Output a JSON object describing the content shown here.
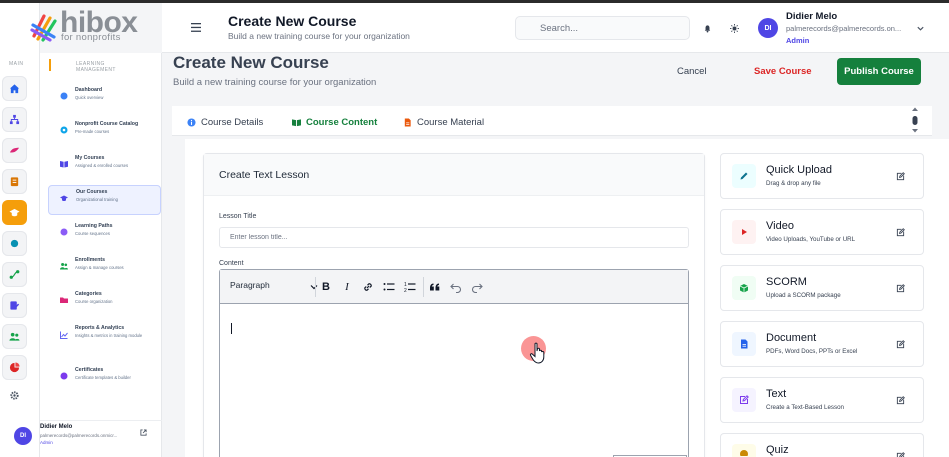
{
  "brand": {
    "name": "hibox",
    "tagline": "for nonprofits"
  },
  "rail": {
    "section": "MAIN"
  },
  "sidebar": {
    "section": "LEARNING MANAGEMENT",
    "items": [
      {
        "title": "Dashboard",
        "subtitle": "Quick overview",
        "icon": "dashboard-icon",
        "color": "#3b82f6"
      },
      {
        "title": "Nonprofit Course Catalog",
        "subtitle": "Pre-made courses",
        "icon": "catalog-icon",
        "color": "#0ea5e9"
      },
      {
        "title": "My Courses",
        "subtitle": "Assigned & enrolled courses",
        "icon": "book-icon",
        "color": "#4f46e5"
      },
      {
        "title": "Our Courses",
        "subtitle": "Organizational training",
        "icon": "graduation-cap-icon",
        "color": "#4f46e5"
      },
      {
        "title": "Learning Paths",
        "subtitle": "Course sequences",
        "icon": "path-icon",
        "color": "#8b5cf6"
      },
      {
        "title": "Enrollments",
        "subtitle": "Assign & manage courses",
        "icon": "users-icon",
        "color": "#16a34a"
      },
      {
        "title": "Categories",
        "subtitle": "Course organization",
        "icon": "folder-icon",
        "color": "#db2777"
      },
      {
        "title": "Reports & Analytics",
        "subtitle": "Insights & metrics in training module",
        "icon": "chart-icon",
        "color": "#6366f1"
      },
      {
        "title": "Certificates",
        "subtitle": "Certificate templates & builder",
        "icon": "certificate-icon",
        "color": "#7c3aed"
      }
    ],
    "user": {
      "initials": "DI",
      "name": "Didier Melo",
      "email": "palmerecords@palmerecords.onmicr...",
      "role": "Admin"
    }
  },
  "header": {
    "title": "Create New Course",
    "subtitle": "Build a new training course for your organization",
    "search_placeholder": "Search...",
    "user": {
      "initials": "DI",
      "name": "Didier Melo",
      "email": "palmerecords@palmerecords.on...",
      "role": "Admin"
    }
  },
  "page": {
    "title": "Create New Course",
    "subtitle": "Build a new training course for your organization",
    "actions": {
      "cancel": "Cancel",
      "save": "Save Course",
      "publish": "Publish Course"
    }
  },
  "tabs": [
    {
      "label": "Course Details",
      "icon": "info-icon"
    },
    {
      "label": "Course Content",
      "icon": "book-open-icon",
      "active": true
    },
    {
      "label": "Course Material",
      "icon": "document-icon"
    }
  ],
  "lesson": {
    "heading": "Create Text Lesson",
    "title_label": "Lesson Title",
    "title_placeholder": "Enter lesson title...",
    "content_label": "Content",
    "block_format": "Paragraph"
  },
  "content_types": [
    {
      "title": "Quick Upload",
      "subtitle": "Drag & drop any file",
      "icon": "pencil-icon",
      "color": "#0e7490",
      "bg": "#ecfeff"
    },
    {
      "title": "Video",
      "subtitle": "Video Uploads, YouTube or URL",
      "icon": "play-icon",
      "color": "#dc2626",
      "bg": "#fef2f2"
    },
    {
      "title": "SCORM",
      "subtitle": "Upload a SCORM package",
      "icon": "package-icon",
      "color": "#16a34a",
      "bg": "#f0fdf4"
    },
    {
      "title": "Document",
      "subtitle": "PDFs, Word Docs, PPTs or Excel",
      "icon": "document-icon",
      "color": "#2563eb",
      "bg": "#eff6ff"
    },
    {
      "title": "Text",
      "subtitle": "Create a Text-Based Lesson",
      "icon": "edit-icon",
      "color": "#7c3aed",
      "bg": "#f5f3ff"
    },
    {
      "title": "Quiz",
      "subtitle": "",
      "icon": "quiz-icon",
      "color": "#ca8a04",
      "bg": "#fefce8"
    }
  ],
  "colors": {
    "accent": "#15803d",
    "save": "#dc2626",
    "brand_orange": "#f59e0b",
    "avatar": "#4f46e5"
  }
}
